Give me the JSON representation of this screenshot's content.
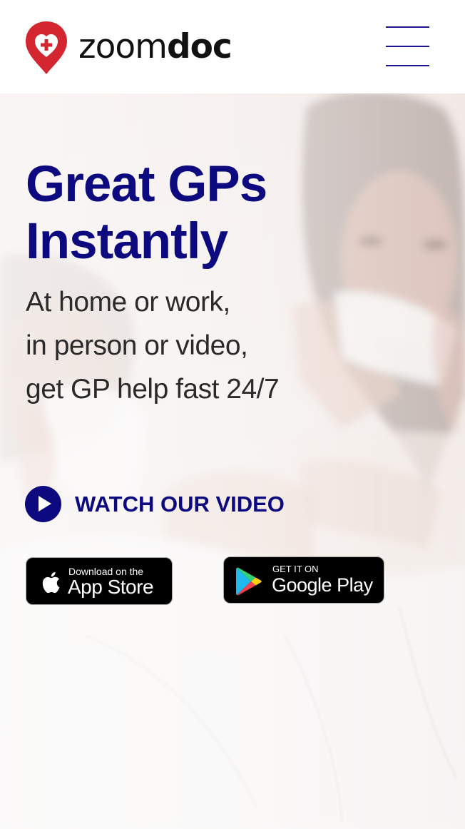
{
  "brand": {
    "name_light": "zoom",
    "name_bold": "doc",
    "pin_color": "#d32630",
    "accent": "#0d0a80"
  },
  "header": {
    "menu_icon": "hamburger-menu-icon"
  },
  "hero": {
    "title": "Great GPs Instantly",
    "subtitle_lines": [
      "At home or work,",
      "in person or video,",
      "get GP help fast 24/7"
    ],
    "watch_video_label": "WATCH OUR VIDEO",
    "watch_video_icon": "play-icon"
  },
  "badges": {
    "app_store": {
      "small": "Download on the",
      "big": "App Store",
      "icon": "apple-icon"
    },
    "google_play": {
      "small": "GET IT ON",
      "big": "Google Play",
      "icon": "google-play-icon"
    }
  }
}
